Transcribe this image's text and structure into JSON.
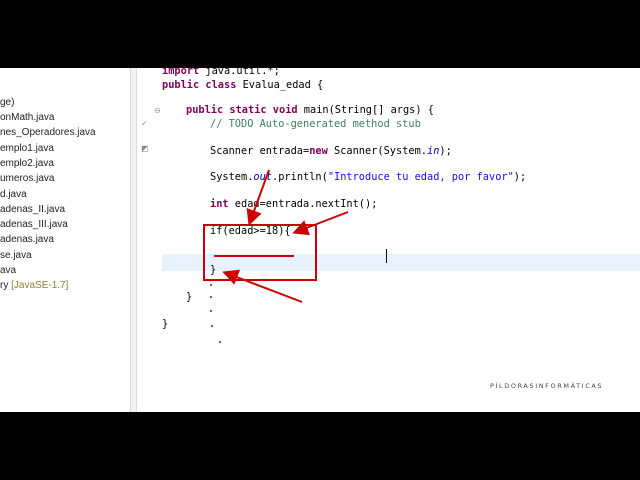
{
  "package_explorer": {
    "items": [
      {
        "label": "ge)"
      },
      {
        "label": "onMath.java"
      },
      {
        "label": "nes_Operadores.java"
      },
      {
        "label": "emplo1.java"
      },
      {
        "label": "emplo2.java"
      },
      {
        "label": "umeros.java"
      },
      {
        "label": "d.java"
      },
      {
        "label": "adenas_II.java"
      },
      {
        "label": "adenas_III.java"
      },
      {
        "label": "adenas.java"
      },
      {
        "label": "se.java"
      },
      {
        "label": "ava"
      },
      {
        "label": "ry",
        "lib": "[JavaSE-1.7]"
      }
    ]
  },
  "editor": {
    "import_kw": "import",
    "import_rest": " java.util.*;",
    "class_kw": "public class",
    "class_rest": " Evalua_edad {",
    "main_kw": "public static void",
    "main_rest": " main(String[] args) {",
    "todo_comment": "// TODO Auto-generated method stub",
    "scanner_a": "Scanner entrada=",
    "scanner_new": "new",
    "scanner_b": " Scanner(System.",
    "scanner_in": "in",
    "scanner_c": ");",
    "println_a": "System.",
    "println_out": "out",
    "println_b": ".println(",
    "println_str": "\"Introduce tu edad, por favor\"",
    "println_c": ");",
    "int_kw": "int",
    "int_rest": " edad=entrada.nextInt();",
    "if_line": "if(edad>=18){",
    "if_close": "}",
    "main_close": "}",
    "class_close": "}"
  },
  "watermark": "PÍLDORASINFORMÁTICAS",
  "colors": {
    "annotation": "#cc0000",
    "keyword": "#7f0055",
    "comment": "#3f7f5f",
    "string": "#2a00ff",
    "current_line": "#e8f2fe"
  }
}
